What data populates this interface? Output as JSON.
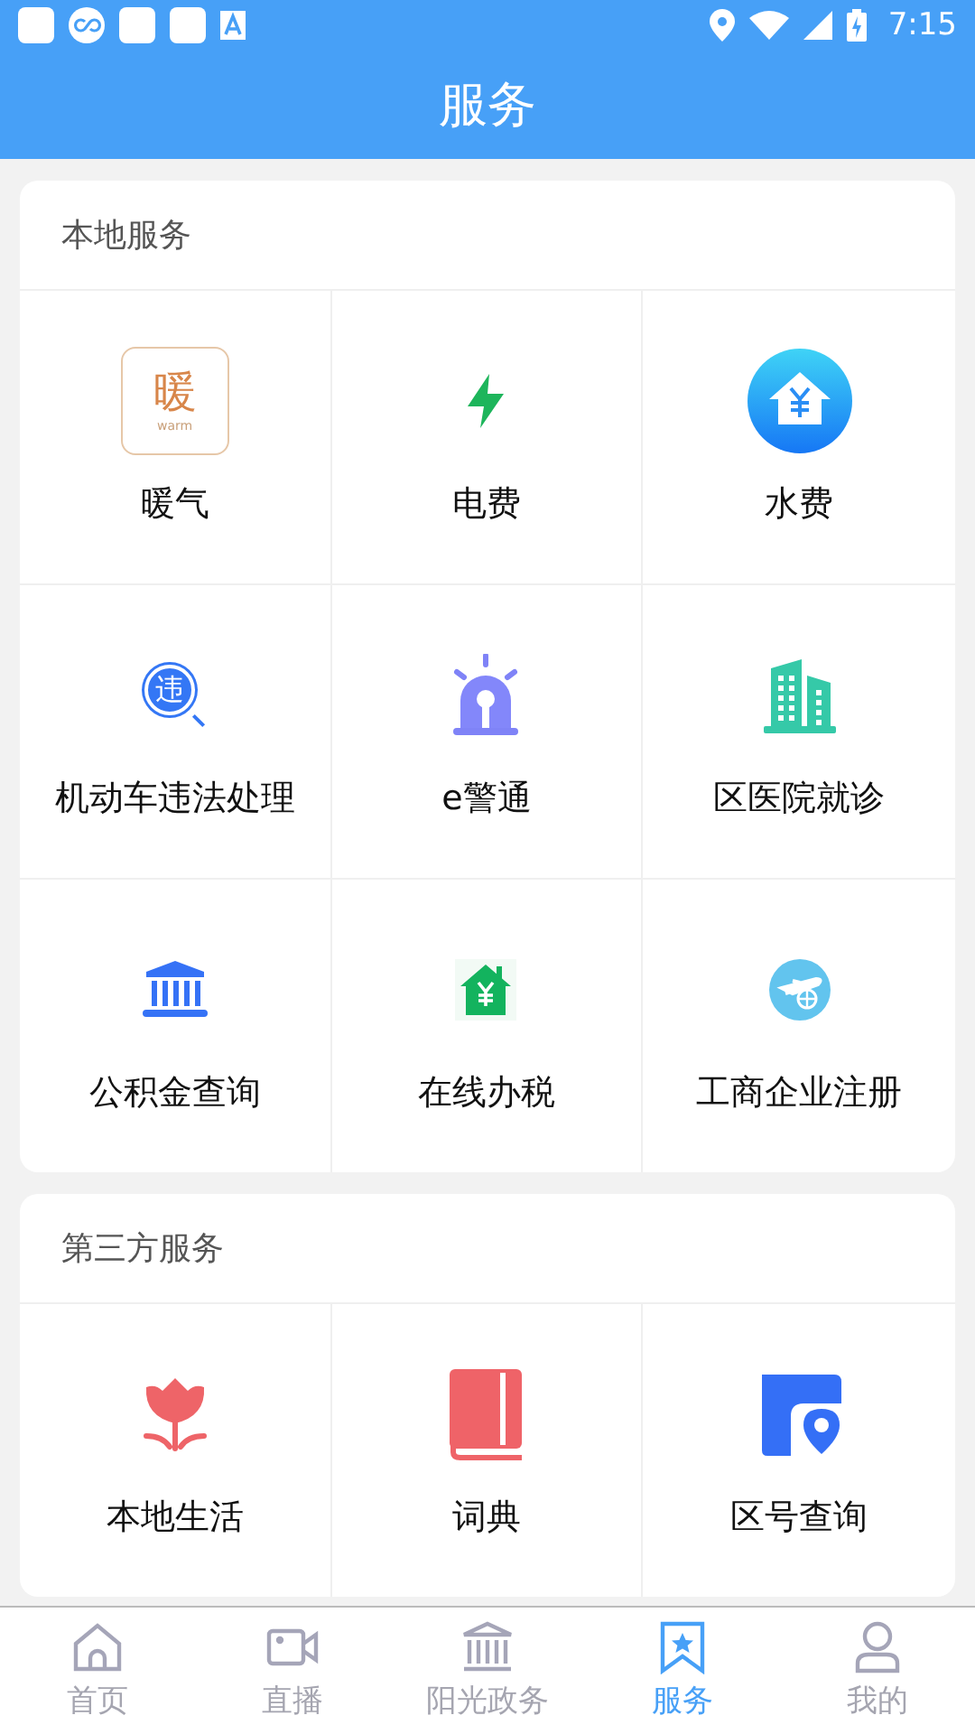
{
  "status_bar": {
    "time": "7:15"
  },
  "header": {
    "title": "服务"
  },
  "sections": [
    {
      "title": "本地服务",
      "items": [
        {
          "label": "暖气",
          "kind": "warm",
          "logo_text": "暖",
          "logo_caption": "warm"
        },
        {
          "label": "电费",
          "kind": "bolt"
        },
        {
          "label": "水费",
          "kind": "water"
        },
        {
          "label": "机动车违法处理",
          "kind": "violation",
          "logo_text": "违"
        },
        {
          "label": "e警通",
          "kind": "police"
        },
        {
          "label": "区医院就诊",
          "kind": "hospital"
        },
        {
          "label": "公积金查询",
          "kind": "bank"
        },
        {
          "label": "在线办税",
          "kind": "tax"
        },
        {
          "label": "工商企业注册",
          "kind": "business"
        }
      ]
    },
    {
      "title": "第三方服务",
      "items": [
        {
          "label": "本地生活",
          "kind": "flower"
        },
        {
          "label": "词典",
          "kind": "book"
        },
        {
          "label": "区号查询",
          "kind": "map"
        }
      ]
    }
  ],
  "tabs": [
    {
      "label": "首页",
      "kind": "home",
      "selected": false
    },
    {
      "label": "直播",
      "kind": "video",
      "selected": false
    },
    {
      "label": "阳光政务",
      "kind": "gov",
      "selected": false
    },
    {
      "label": "服务",
      "kind": "star",
      "selected": true
    },
    {
      "label": "我的",
      "kind": "user",
      "selected": false
    }
  ]
}
